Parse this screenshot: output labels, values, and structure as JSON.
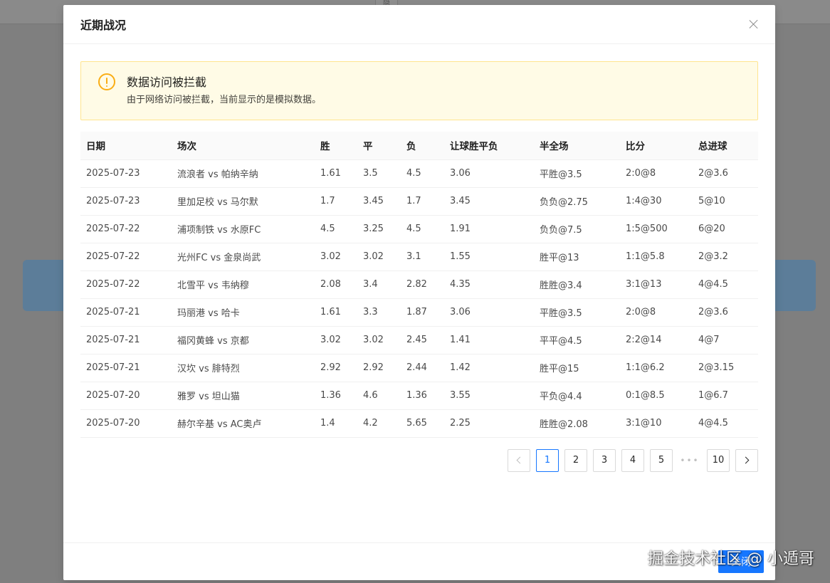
{
  "background": {
    "tab_label": "隐"
  },
  "modal": {
    "title": "近期战况",
    "close_label": "×",
    "footer_button": "关闭"
  },
  "alert": {
    "type": "warning",
    "title": "数据访问被拦截",
    "description": "由于网络访问被拦截，当前显示的是模拟数据。"
  },
  "table": {
    "columns": [
      "日期",
      "场次",
      "胜",
      "平",
      "负",
      "让球胜平负",
      "半全场",
      "比分",
      "总进球"
    ],
    "rows": [
      [
        "2025-07-23",
        "流浪者 vs 帕纳辛纳",
        "1.61",
        "3.5",
        "4.5",
        "3.06",
        "平胜@3.5",
        "2:0@8",
        "2@3.6"
      ],
      [
        "2025-07-23",
        "里加足校 vs 马尔默",
        "1.7",
        "3.45",
        "1.7",
        "3.45",
        "负负@2.75",
        "1:4@30",
        "5@10"
      ],
      [
        "2025-07-22",
        "浦项制铁 vs 水原FC",
        "4.5",
        "3.25",
        "4.5",
        "1.91",
        "负负@7.5",
        "1:5@500",
        "6@20"
      ],
      [
        "2025-07-22",
        "光州FC vs 金泉尚武",
        "3.02",
        "3.02",
        "3.1",
        "1.55",
        "胜平@13",
        "1:1@5.8",
        "2@3.2"
      ],
      [
        "2025-07-22",
        "北雪平 vs 韦纳穆",
        "2.08",
        "3.4",
        "2.82",
        "4.35",
        "胜胜@3.4",
        "3:1@13",
        "4@4.5"
      ],
      [
        "2025-07-21",
        "玛丽港 vs 哈卡",
        "1.61",
        "3.3",
        "1.87",
        "3.06",
        "平胜@3.5",
        "2:0@8",
        "2@3.6"
      ],
      [
        "2025-07-21",
        "福冈黄蜂 vs 京都",
        "3.02",
        "3.02",
        "2.45",
        "1.41",
        "平平@4.5",
        "2:2@14",
        "4@7"
      ],
      [
        "2025-07-21",
        "汉坎 vs 腓特烈",
        "2.92",
        "2.92",
        "2.44",
        "1.42",
        "胜平@15",
        "1:1@6.2",
        "2@3.15"
      ],
      [
        "2025-07-20",
        "雅罗 vs 坦山猫",
        "1.36",
        "4.6",
        "1.36",
        "3.55",
        "平负@4.4",
        "0:1@8.5",
        "1@6.7"
      ],
      [
        "2025-07-20",
        "赫尔辛基 vs AC奥卢",
        "1.4",
        "4.2",
        "5.65",
        "2.25",
        "胜胜@2.08",
        "3:1@10",
        "4@4.5"
      ]
    ]
  },
  "pagination": {
    "pages": [
      "1",
      "2",
      "3",
      "4",
      "5"
    ],
    "ellipsis": "•••",
    "last_page": "10",
    "current": "1"
  },
  "watermark": "掘金技术社区 @ 小遁哥"
}
